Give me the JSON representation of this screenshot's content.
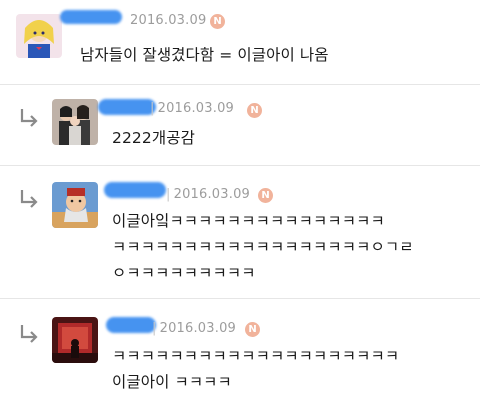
{
  "comments": [
    {
      "date": "2016.03.09",
      "badge": "N",
      "text": "남자들이 잘생겼다함 = 이글아이 나옴"
    },
    {
      "date": "2016.03.09",
      "badge": "N",
      "text": "2222개공감"
    },
    {
      "date": "2016.03.09",
      "badge": "N",
      "lines": [
        "이글아잌ㅋㅋㅋㅋㅋㅋㅋㅋㅋㅋㅋㅋㅋㅋㅋ",
        "ㅋㅋㅋㅋㅋㅋㅋㅋㅋㅋㅋㅋㅋㅋㅋㅋㅋㅋㅇㄱㄹ",
        "ㅇㅋㅋㅋㅋㅋㅋㅋㅋㅋ"
      ]
    },
    {
      "date": "2016.03.09",
      "badge": "N",
      "lines": [
        "ㅋㅋㅋㅋㅋㅋㅋㅋㅋㅋㅋㅋㅋㅋㅋㅋㅋㅋㅋㅋ",
        "이글아이 ㅋㅋㅋㅋ"
      ]
    }
  ],
  "icons": {
    "reply": "reply-arrow-icon",
    "new_badge": "new-badge-icon"
  },
  "colors": {
    "name_redaction": "#3d8ef0",
    "badge": "#f1b39b",
    "meta": "#9c9c9c"
  }
}
